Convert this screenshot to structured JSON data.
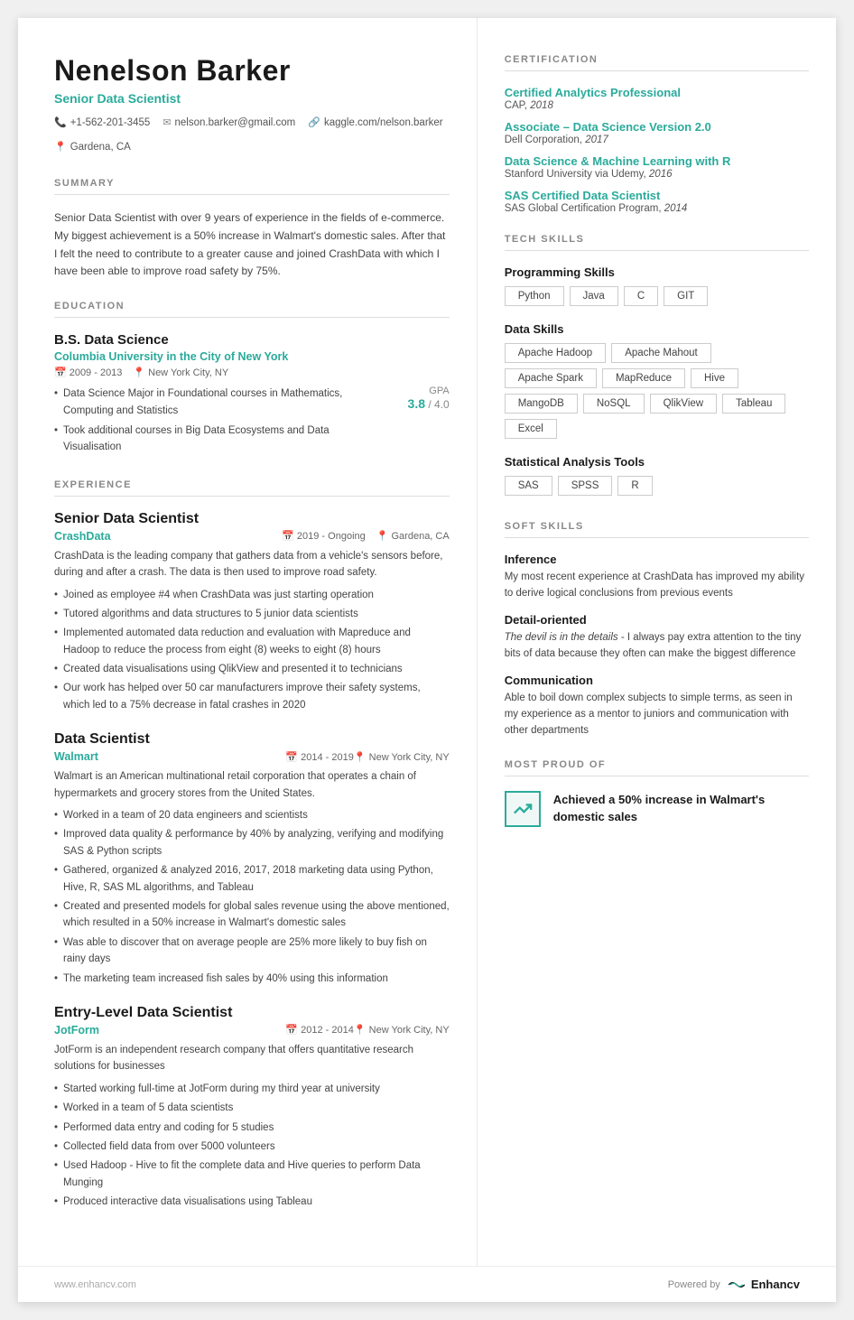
{
  "header": {
    "name": "Nenelson Barker",
    "title": "Senior Data Scientist",
    "phone": "+1-562-201-3455",
    "email": "nelson.barker@gmail.com",
    "kaggle": "kaggle.com/nelson.barker",
    "location": "Gardena, CA"
  },
  "summary": {
    "section_label": "SUMMARY",
    "text": "Senior Data Scientist with over 9 years of experience in the fields of e-commerce. My biggest achievement is a 50% increase in Walmart's domestic sales. After that I felt the need to contribute to a greater cause and joined CrashData with which I have been able to improve road safety by 75%."
  },
  "education": {
    "section_label": "EDUCATION",
    "degree": "B.S. Data Science",
    "school": "Columbia University in the City of New York",
    "dates": "2009 - 2013",
    "location": "New York City, NY",
    "gpa_label": "GPA",
    "gpa_value": "3.8",
    "gpa_max": "4.0",
    "bullets": [
      "Data Science Major in Foundational courses in Mathematics, Computing and Statistics",
      "Took additional courses in Big Data Ecosystems and Data Visualisation"
    ]
  },
  "experience": {
    "section_label": "EXPERIENCE",
    "jobs": [
      {
        "title": "Senior Data Scientist",
        "company": "CrashData",
        "dates": "2019 - Ongoing",
        "location": "Gardena, CA",
        "description": "CrashData is the leading company that gathers data from a vehicle's sensors before, during and after a crash. The data is then used to improve road safety.",
        "bullets": [
          "Joined as employee #4 when CrashData was just starting operation",
          "Tutored algorithms and data structures to 5 junior data scientists",
          "Implemented automated data reduction and evaluation with Mapreduce and Hadoop to reduce the process from eight (8) weeks to eight (8) hours",
          "Created data visualisations using QlikView and presented it to technicians",
          "Our work has helped over 50 car manufacturers improve their safety systems, which led to a 75% decrease in fatal crashes in 2020"
        ]
      },
      {
        "title": "Data Scientist",
        "company": "Walmart",
        "dates": "2014 - 2019",
        "location": "New York City, NY",
        "description": "Walmart is an American multinational retail corporation that operates a chain of hypermarkets and grocery stores from the United States.",
        "bullets": [
          "Worked in a team of 20 data engineers and scientists",
          "Improved data quality & performance by 40% by analyzing, verifying and modifying SAS & Python scripts",
          "Gathered, organized & analyzed 2016, 2017, 2018 marketing data using Python, Hive, R, SAS ML algorithms, and Tableau",
          "Created and presented models for global sales revenue using the above mentioned, which resulted in a 50% increase in Walmart's domestic sales",
          "Was able to discover that on average people are 25% more likely to buy fish on rainy days",
          "The marketing team increased fish sales by 40% using this information"
        ]
      },
      {
        "title": "Entry-Level Data Scientist",
        "company": "JotForm",
        "dates": "2012 - 2014",
        "location": "New York City, NY",
        "description": "JotForm is an independent research company that offers quantitative research solutions for businesses",
        "bullets": [
          "Started working full-time at JotForm during my third year at university",
          "Worked in a team of 5 data scientists",
          "Performed data entry and coding for 5 studies",
          "Collected field data from over 5000 volunteers",
          "Used Hadoop - Hive to fit the complete data and Hive queries to perform Data Munging",
          "Produced interactive data visualisations using Tableau"
        ]
      }
    ]
  },
  "certification": {
    "section_label": "CERTIFICATION",
    "items": [
      {
        "title": "Certified Analytics Professional",
        "subtitle": "CAP, 2018"
      },
      {
        "title": "Associate – Data Science Version 2.0",
        "subtitle": "Dell Corporation, 2017"
      },
      {
        "title": "Data Science & Machine Learning with R",
        "subtitle": "Stanford University via Udemy, 2016"
      },
      {
        "title": "SAS Certified Data Scientist",
        "subtitle": "SAS Global Certification Program, 2014"
      }
    ]
  },
  "tech_skills": {
    "section_label": "TECH SKILLS",
    "categories": [
      {
        "name": "Programming Skills",
        "tags": [
          "Python",
          "Java",
          "C",
          "GIT"
        ]
      },
      {
        "name": "Data Skills",
        "tags": [
          "Apache Hadoop",
          "Apache Mahout",
          "Apache Spark",
          "MapReduce",
          "Hive",
          "MangoDB",
          "NoSQL",
          "QlikView",
          "Tableau",
          "Excel"
        ]
      },
      {
        "name": "Statistical Analysis Tools",
        "tags": [
          "SAS",
          "SPSS",
          "R"
        ]
      }
    ]
  },
  "soft_skills": {
    "section_label": "SOFT SKILLS",
    "items": [
      {
        "name": "Inference",
        "description": "My most recent experience at CrashData has improved my ability to derive logical conclusions from previous events"
      },
      {
        "name": "Detail-oriented",
        "description_italic": "The devil is in the details",
        "description_rest": " - I always pay extra attention to the tiny bits of data because they often can make the biggest difference"
      },
      {
        "name": "Communication",
        "description": "Able to boil down complex subjects to simple terms, as seen in my experience as a mentor to juniors and communication with other departments"
      }
    ]
  },
  "most_proud": {
    "section_label": "MOST PROUD OF",
    "item": {
      "icon": "↗",
      "text": "Achieved a 50% increase in Walmart's domestic sales"
    }
  },
  "footer": {
    "website": "www.enhancv.com",
    "powered_by": "Powered by",
    "brand": "Enhancv"
  }
}
